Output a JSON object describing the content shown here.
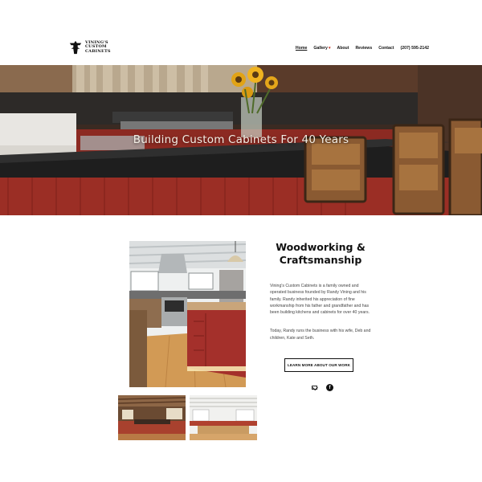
{
  "brand": {
    "line1": "VINING'S",
    "line2": "CUSTOM",
    "line3": "CABINETS"
  },
  "nav": {
    "items": [
      {
        "label": "Home",
        "active": true
      },
      {
        "label": "Gallery",
        "has_dropdown": true
      },
      {
        "label": "About"
      },
      {
        "label": "Reviews"
      },
      {
        "label": "Contact"
      },
      {
        "label": "(207) 595-2142"
      }
    ]
  },
  "hero": {
    "title": "Building Custom Cabinets For 40 Years"
  },
  "about": {
    "heading": "Woodworking & Craftsmanship",
    "paragraph1": "Vining's Custom Cabinets is a family owned and operated business founded by Randy Vining and his family. Randy inherited his appreciation of fine workmanship from his father and grandfather and has been building kitchens and cabinets for over 40 years.",
    "paragraph2": "Today, Randy runs the business with his wife, Deb and children, Kate and Seth.",
    "cta_label": "LEARN MORE ABOUT OUR WORK"
  },
  "social": {
    "icons": [
      "mail-icon",
      "facebook-icon"
    ]
  },
  "colors": {
    "accent_red": "#b03a2e",
    "dark_text": "#111111"
  }
}
